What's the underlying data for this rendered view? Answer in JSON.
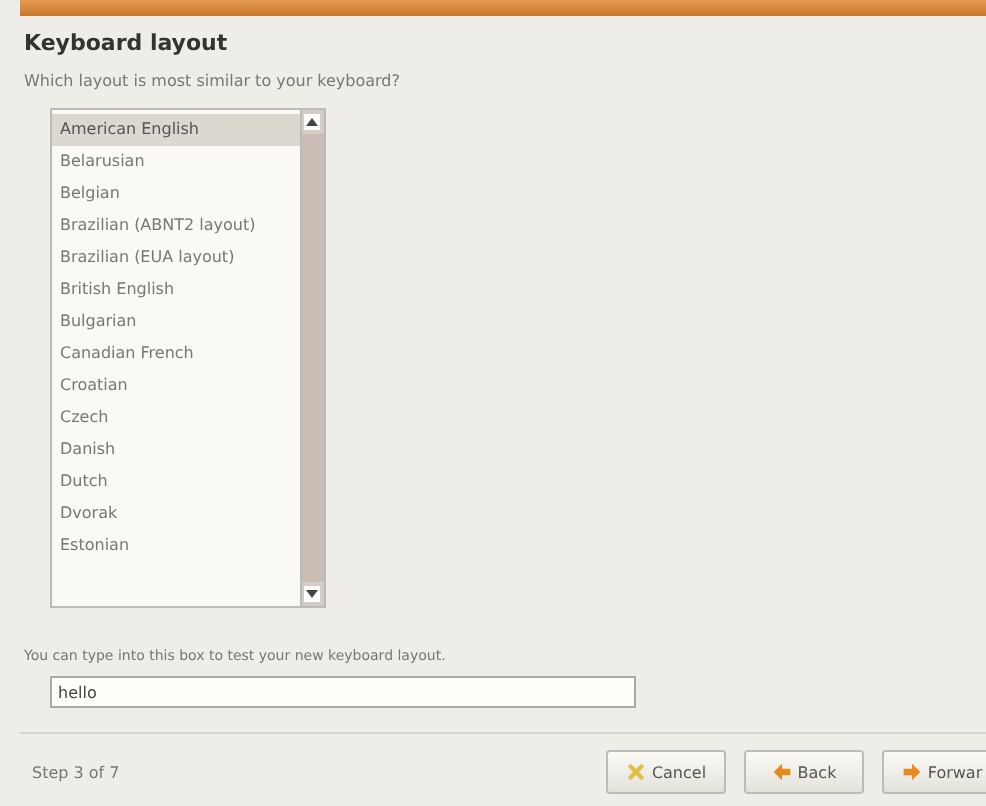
{
  "window": {
    "title": "Keyboard layout"
  },
  "question": "Which layout is most similar to your keyboard?",
  "layouts": [
    {
      "label": "American English",
      "selected": true
    },
    {
      "label": "Belarusian",
      "selected": false
    },
    {
      "label": "Belgian",
      "selected": false
    },
    {
      "label": "Brazilian (ABNT2 layout)",
      "selected": false
    },
    {
      "label": "Brazilian (EUA layout)",
      "selected": false
    },
    {
      "label": "British English",
      "selected": false
    },
    {
      "label": "Bulgarian",
      "selected": false
    },
    {
      "label": "Canadian French",
      "selected": false
    },
    {
      "label": "Croatian",
      "selected": false
    },
    {
      "label": "Czech",
      "selected": false
    },
    {
      "label": "Danish",
      "selected": false
    },
    {
      "label": "Dutch",
      "selected": false
    },
    {
      "label": "Dvorak",
      "selected": false
    },
    {
      "label": "Estonian",
      "selected": false
    }
  ],
  "test": {
    "label": "You can type into this box to test your new keyboard layout.",
    "value": "hello"
  },
  "step": "Step 3 of 7",
  "buttons": [
    {
      "label": "Cancel",
      "kind": "cancel"
    },
    {
      "label": "Back",
      "kind": "back"
    },
    {
      "label": "Forwar",
      "kind": "forward"
    }
  ]
}
